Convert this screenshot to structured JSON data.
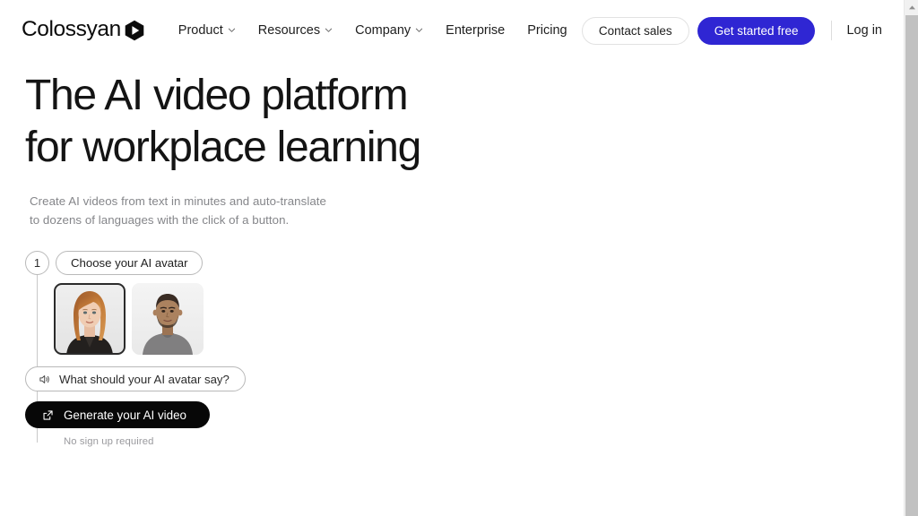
{
  "brand": {
    "name": "Colossyan",
    "logo_icon": "hexagon-play-icon",
    "accent_color": "#2f26d3",
    "text_color": "#141414"
  },
  "header": {
    "nav": [
      {
        "label": "Product",
        "has_dropdown": true,
        "icon": "chevron-down-icon"
      },
      {
        "label": "Resources",
        "has_dropdown": true,
        "icon": "chevron-down-icon"
      },
      {
        "label": "Company",
        "has_dropdown": true,
        "icon": "chevron-down-icon"
      },
      {
        "label": "Enterprise",
        "has_dropdown": false
      },
      {
        "label": "Pricing",
        "has_dropdown": false
      }
    ],
    "contact_sales_label": "Contact sales",
    "get_started_label": "Get started free",
    "login_label": "Log in"
  },
  "hero": {
    "headline_line1": "The AI video platform",
    "headline_line2": "for workplace learning",
    "subhead_line1": "Create AI videos from text in minutes and auto-translate",
    "subhead_line2": "to dozens of languages with the click of a button."
  },
  "widget": {
    "step_number": "1",
    "step_label": "Choose your AI avatar",
    "avatars": [
      {
        "name": "avatar-female-red-hair",
        "selected": true
      },
      {
        "name": "avatar-male-grey-shirt",
        "selected": false
      }
    ],
    "say_placeholder": "What should your AI avatar say?",
    "say_icon": "speaker-icon",
    "generate_label": "Generate your AI video",
    "generate_icon": "external-link-icon",
    "footnote": "No sign up required"
  },
  "scrollbar": {
    "up_arrow_icon": "triangle-up-icon",
    "position": "top"
  }
}
